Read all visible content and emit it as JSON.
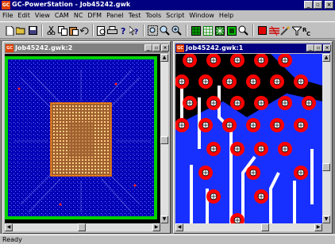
{
  "app": {
    "title": "GC-PowerStation - Job45242.gwk",
    "icon_label": "GC",
    "window_buttons": [
      "_",
      "▫",
      "×"
    ]
  },
  "menu": [
    "File",
    "Edit",
    "View",
    "CAM",
    "NC",
    "DFM",
    "Panel",
    "Test",
    "Tools",
    "Script",
    "Window",
    "Help"
  ],
  "toolbar": {
    "groups": [
      [
        "new-icon",
        "open-icon",
        "save-icon"
      ],
      [
        "cut-icon",
        "copy-icon",
        "paste-icon",
        "undo-icon"
      ],
      [
        "print-preview-icon",
        "print-icon",
        "help-icon",
        "context-help-icon"
      ],
      [
        "zoom-window-icon",
        "zoom-all-icon",
        "zoom-in-icon"
      ],
      [
        "layers-icon",
        "grid-icon",
        "sparkle-icon",
        "fill-icon",
        "query-icon"
      ],
      [
        "stop-icon",
        "netlist-icon",
        "magic-wand-icon",
        "filter-icon",
        "rc-icon"
      ]
    ]
  },
  "windows": [
    {
      "title": "Job45242.gwk:2",
      "icon": "GC",
      "buttons": [
        "_",
        "▫",
        "×"
      ]
    },
    {
      "title": "Job45242.gwk:1",
      "icon": "GC",
      "buttons": [
        "_",
        "▫",
        "×"
      ]
    }
  ],
  "scroll": {
    "up": "▲",
    "down": "▼",
    "left": "◀",
    "right": "▶"
  },
  "status": {
    "text": "Ready"
  },
  "colors": {
    "titlebar_active": "#000080",
    "titlebar_inactive": "#808080",
    "board_background": "#0000a0",
    "board_border": "#00d000",
    "pad_red": "#ff0000",
    "copper_blue": "#1830ff"
  }
}
